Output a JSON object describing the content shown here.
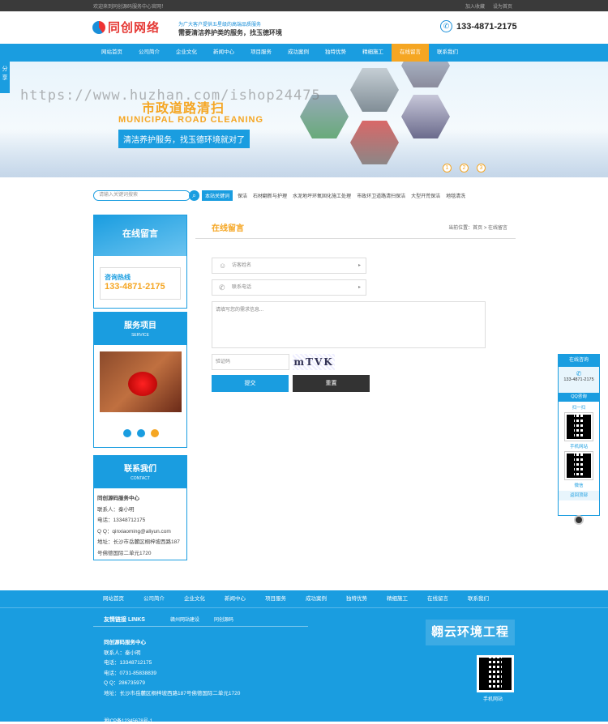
{
  "topbar": {
    "welcome": "欢迎来到同创源码服务中心官网！",
    "links": [
      "加入收藏",
      "设为首页"
    ]
  },
  "header": {
    "logo": "同创网络",
    "slogan_top": "为广大客户提供五星级的高端品质服务",
    "slogan_main": "需要清洁养护类的服务，找玉德环境",
    "phone": "133-4871-2175"
  },
  "nav": {
    "items": [
      "网站首页",
      "公司简介",
      "企业文化",
      "新闻中心",
      "项目服务",
      "成功案例",
      "独特优势",
      "精细施工",
      "在线留言",
      "联系我们"
    ],
    "active": "在线留言"
  },
  "share": "分享",
  "banner": {
    "title": "市政道路清扫",
    "subtitle": "MUNICIPAL ROAD CLEANING",
    "slogan": "清洁养护服务，找玉德环境就对了",
    "dots": [
      "1",
      "2",
      "3"
    ],
    "watermark": "https://www.huzhan.com/ishop24475"
  },
  "search": {
    "placeholder": "请输入关键词搜索",
    "hot_label": "本站关键词",
    "hot": [
      "保洁",
      "石材翻新与护理",
      "水泥地坪环氧固化施工处理",
      "市政环卫道路清扫保洁",
      "大型开荒保洁",
      "地毯清洗"
    ]
  },
  "side_message": {
    "title": "在线留言",
    "hotline_label": "咨询热线",
    "hotline": "133-4871-2175"
  },
  "side_service": {
    "title": "服务项目",
    "subtitle": "SERVICE"
  },
  "side_contact": {
    "title": "联系我们",
    "subtitle": "CONTACT",
    "company": "同创源码服务中心",
    "person": "联系人：秦小明",
    "tel": "电话：13348712175",
    "qq": "Q Q：qinxiaoming@aliyun.com",
    "addr1": "地址：长沙市岳麓区桐梓坡西路187",
    "addr2": "号佛德国际二单元1720"
  },
  "main": {
    "title": "在线留言",
    "breadcrumb": "当前位置：首页 > 在线留言"
  },
  "form": {
    "name_placeholder": "访客姓名",
    "phone_placeholder": "联系电话",
    "content_placeholder": "请填写您的需求信息...",
    "captcha_placeholder": "验证码",
    "captcha_text": "mTVK",
    "submit": "提交",
    "reset": "重置"
  },
  "float_panel": {
    "title": "在线咨询",
    "phone": "133-4871-2175",
    "qq": "QQ咨询",
    "scan": "扫一扫",
    "mobile": "手机网站",
    "wechat": "微信",
    "back_top": "返回顶部"
  },
  "footer_nav": [
    "网站首页",
    "公司简介",
    "企业文化",
    "新闻中心",
    "项目服务",
    "成功案例",
    "独特优势",
    "精细施工",
    "在线留言",
    "联系我们"
  ],
  "footer": {
    "friend_title": "友情链接  LINKS",
    "friend_links": [
      "赣州网站建设",
      "同创源码"
    ],
    "company": "同创源码服务中心",
    "person": "联系人：秦小明",
    "tel": "电话：13348712175",
    "phone": "电话：0731-85838839",
    "qq": "Q Q：286735979",
    "addr": "地址：长沙市岳麓区桐梓坡西路187号佛德国际二单元1720",
    "brand": "翱云环境工程",
    "qr_label": "手机网站",
    "icp": "湘ICP备12345678号-1"
  }
}
